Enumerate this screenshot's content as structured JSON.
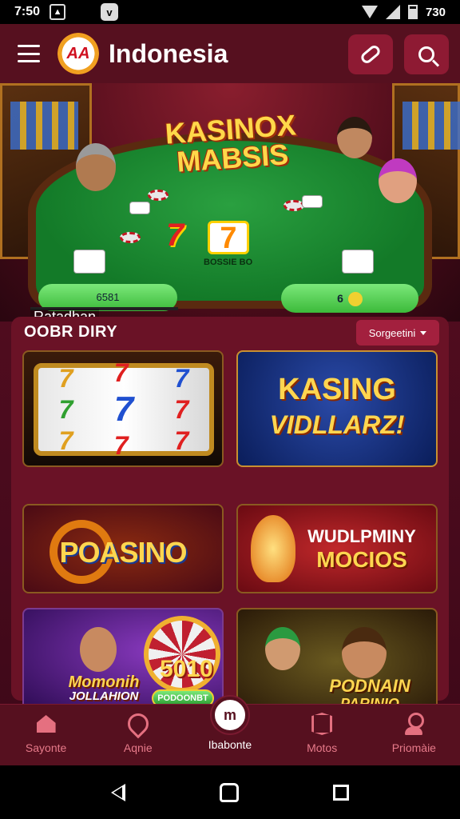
{
  "status_bar": {
    "time": "7:50",
    "battery": "730"
  },
  "header": {
    "logo_text": "AA",
    "brand": "Indonesia",
    "icons": [
      "menu-icon",
      "link-icon",
      "search-icon"
    ]
  },
  "hero": {
    "title": "KASINOX MABSIS",
    "table_caption": "BOSSIE BO",
    "pill_left": "6581",
    "pill_right": "6",
    "label": "Ratadhan"
  },
  "section": {
    "title": "OOBR DIRY",
    "sort_label": "Sorgeetini"
  },
  "tiles": [
    {
      "name": "slot-reels",
      "reel_a": [
        "7",
        "7",
        "7"
      ],
      "reel_b": [
        "7",
        "7",
        "7"
      ],
      "reel_c": [
        "7",
        "7",
        "7"
      ]
    },
    {
      "name": "kasing-vidllarz",
      "line1": "KASING",
      "line2": "VIDLLARZ!"
    },
    {
      "name": "poasino",
      "line1": "POASINO"
    },
    {
      "name": "wudlpminy-mocios",
      "line1": "WUDLPMINY",
      "line2": "MOCIOS"
    },
    {
      "name": "momonih-jolllahion",
      "line1": "Momonih",
      "line2": "JOLLAHION",
      "badge": "5010",
      "pill": "PODOONBT"
    },
    {
      "name": "podnain-parinio",
      "line1": "PODNAIN",
      "line2": "PARINIO"
    }
  ],
  "bottom_nav": [
    {
      "label": "Sayonte",
      "icon": "home-icon"
    },
    {
      "label": "Aqnie",
      "icon": "pin-icon"
    },
    {
      "label": "Ibabonte",
      "icon_text": "m",
      "icon": "center-icon"
    },
    {
      "label": "Motos",
      "icon": "badge-icon"
    },
    {
      "label": "Priomàie",
      "icon": "profile-icon"
    }
  ],
  "colors": {
    "primary": "#56101f",
    "accent": "#a3203e",
    "nav_text": "#e77a8a"
  }
}
